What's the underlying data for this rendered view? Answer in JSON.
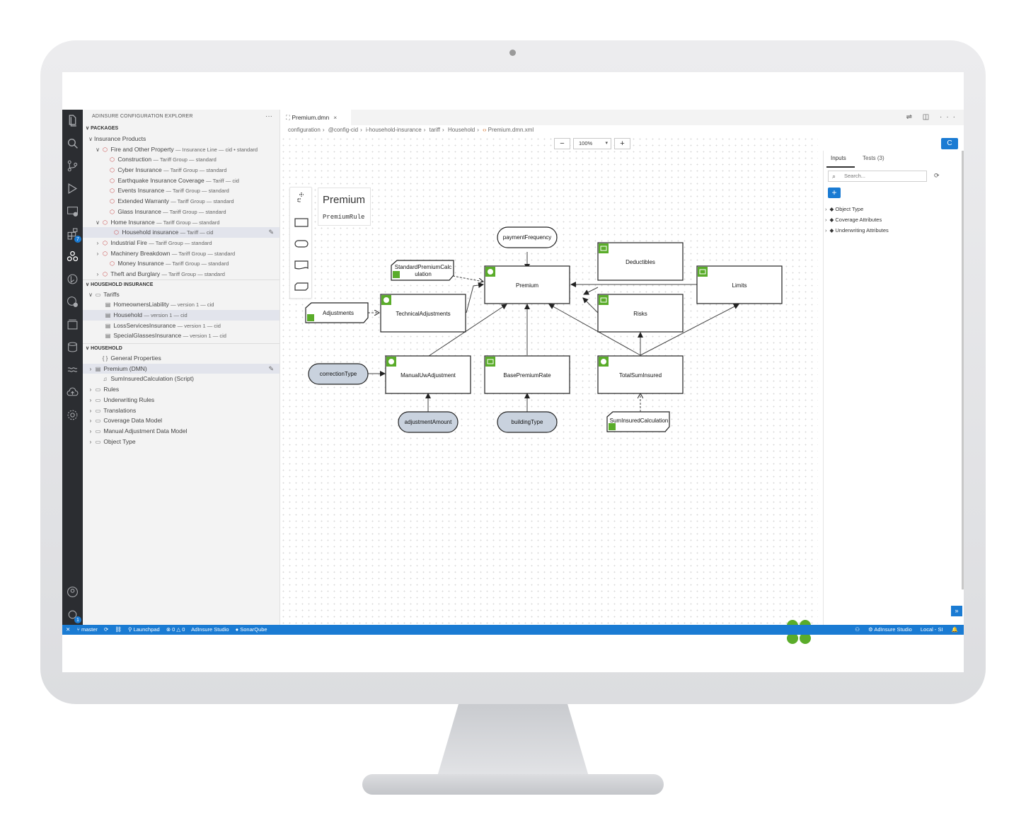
{
  "explorer": {
    "title": "ADINSURE CONFIGURATION EXPLORER",
    "more": "···",
    "packages_header": "PACKAGES",
    "packages": [
      {
        "chev": "∨",
        "icon": "",
        "label": "Insurance Products",
        "meta": "",
        "indent": 6
      },
      {
        "chev": "∨",
        "icon": "⬡",
        "label": "Fire and Other Property",
        "meta": "— Insurance Line — cid • standard",
        "indent": 16
      },
      {
        "chev": "",
        "icon": "⬡",
        "label": "Construction",
        "meta": "— Tariff Group — standard",
        "indent": 26
      },
      {
        "chev": "",
        "icon": "⬡",
        "label": "Cyber Insurance",
        "meta": "— Tariff Group — standard",
        "indent": 26
      },
      {
        "chev": "",
        "icon": "⬡",
        "label": "Earthquake Insurance Coverage",
        "meta": "— Tariff — cid",
        "indent": 26
      },
      {
        "chev": "",
        "icon": "⬡",
        "label": "Events Insurance",
        "meta": "— Tariff Group — standard",
        "indent": 26
      },
      {
        "chev": "",
        "icon": "⬡",
        "label": "Extended Warranty",
        "meta": "— Tariff Group — standard",
        "indent": 26
      },
      {
        "chev": "",
        "icon": "⬡",
        "label": "Glass Insurance",
        "meta": "— Tariff Group — standard",
        "indent": 26
      },
      {
        "chev": "∨",
        "icon": "⬡",
        "label": "Home Insurance",
        "meta": "— Tariff Group — standard",
        "indent": 16
      },
      {
        "chev": "",
        "icon": "⬡",
        "label": "Household insurance",
        "meta": "— Tariff — cid",
        "indent": 32,
        "selected": true
      },
      {
        "chev": "›",
        "icon": "⬡",
        "label": "Industrial Fire",
        "meta": "— Tariff Group — standard",
        "indent": 16
      },
      {
        "chev": "›",
        "icon": "⬡",
        "label": "Machinery Breakdown",
        "meta": "— Tariff Group — standard",
        "indent": 16
      },
      {
        "chev": "",
        "icon": "⬡",
        "label": "Money Insurance",
        "meta": "— Tariff Group — standard",
        "indent": 26
      },
      {
        "chev": "›",
        "icon": "⬡",
        "label": "Theft and Burglary",
        "meta": "— Tariff Group — standard",
        "indent": 16
      }
    ],
    "household_insurance_header": "HOUSEHOLD INSURANCE",
    "tariffs": [
      {
        "chev": "∨",
        "icon": "▭",
        "label": "Tariffs",
        "meta": "",
        "indent": 6
      },
      {
        "chev": "",
        "icon": "▤",
        "label": "HomeownersLiability",
        "meta": "— version 1 — cid",
        "indent": 20
      },
      {
        "chev": "",
        "icon": "▤",
        "label": "Household",
        "meta": "— version 1 — cid",
        "indent": 20,
        "selected": true
      },
      {
        "chev": "",
        "icon": "▤",
        "label": "LossServicesInsurance",
        "meta": "— version 1 — cid",
        "indent": 20
      },
      {
        "chev": "",
        "icon": "▤",
        "label": "SpecialGlassesInsurance",
        "meta": "— version 1 — cid",
        "indent": 20
      }
    ],
    "household_header": "HOUSEHOLD",
    "household": [
      {
        "chev": "",
        "icon": "{ }",
        "label": "General Properties",
        "meta": "",
        "indent": 16
      },
      {
        "chev": "›",
        "icon": "▤",
        "label": "Premium (DMN)",
        "meta": "",
        "indent": 6,
        "selected": true
      },
      {
        "chev": "",
        "icon": "♫",
        "label": "SumInsuredCalculation (Script)",
        "meta": "",
        "indent": 16
      },
      {
        "chev": "›",
        "icon": "▭",
        "label": "Rules",
        "meta": "",
        "indent": 6
      },
      {
        "chev": "›",
        "icon": "▭",
        "label": "Underwriting Rules",
        "meta": "",
        "indent": 6
      },
      {
        "chev": "›",
        "icon": "▭",
        "label": "Translations",
        "meta": "",
        "indent": 6
      },
      {
        "chev": "›",
        "icon": "▭",
        "label": "Coverage Data Model",
        "meta": "",
        "indent": 6
      },
      {
        "chev": "›",
        "icon": "▭",
        "label": "Manual Adjustment Data Model",
        "meta": "",
        "indent": 6
      },
      {
        "chev": "›",
        "icon": "▭",
        "label": "Object Type",
        "meta": "",
        "indent": 6
      }
    ]
  },
  "editor": {
    "tab_label": "Premium.dmn",
    "tab_close": "×",
    "tab_actions": "⇌ ◫ ···",
    "breadcrumb": [
      "configuration",
      "@config-cid",
      "i-household-insurance",
      "tariff",
      "Household"
    ],
    "breadcrumb_file": "Premium.dmn.xml",
    "breadcrumb_file_icon": "‹›",
    "zoom_minus": "−",
    "zoom_level": "100%",
    "zoom_plus": "+",
    "refresh": "C"
  },
  "diagram": {
    "title": "Premium",
    "subtitle": "PremiumRule",
    "nodes": {
      "paymentFrequency": "paymentFrequency",
      "standardPremium1": "StandardPremiumCalc",
      "standardPremium2": "ulation",
      "premium": "Premium",
      "deductibles": "Deductibles",
      "limits": "Limits",
      "risks": "Risks",
      "adjustments": "Adjustments",
      "technicalAdjustments": "TechnicalAdjustments",
      "correctionType": "correctionType",
      "manualUwAdjustment": "ManualUwAdjustment",
      "basePremiumRate": "BasePremiumRate",
      "totalSumInsured": "TotalSumInsured",
      "adjustmentAmount": "adjustmentAmount",
      "buildingType": "buildingType",
      "sumInsuredCalculation": "SumInsuredCalculation"
    }
  },
  "right_panel": {
    "tabs": [
      "Inputs",
      "Tests (3)"
    ],
    "search_placeholder": "Search...",
    "add": "+",
    "tree": [
      "Object Type",
      "Coverage Attributes",
      "Underwriting Attributes"
    ],
    "expand": "»"
  },
  "statusbar": {
    "left": [
      "✕",
      "⑂ master",
      "⟳",
      "⛓",
      "⚲ Launchpad",
      "⊗ 0 △ 0",
      "AdInsure Studio",
      "● SonarQube"
    ],
    "right": [
      "⚇",
      "⚙ AdInsure Studio",
      "Local - SI",
      "🔔"
    ]
  },
  "colors": {
    "accent": "#1a7bd3",
    "green": "#5aac2a",
    "activity_bg": "#2b2d31"
  }
}
